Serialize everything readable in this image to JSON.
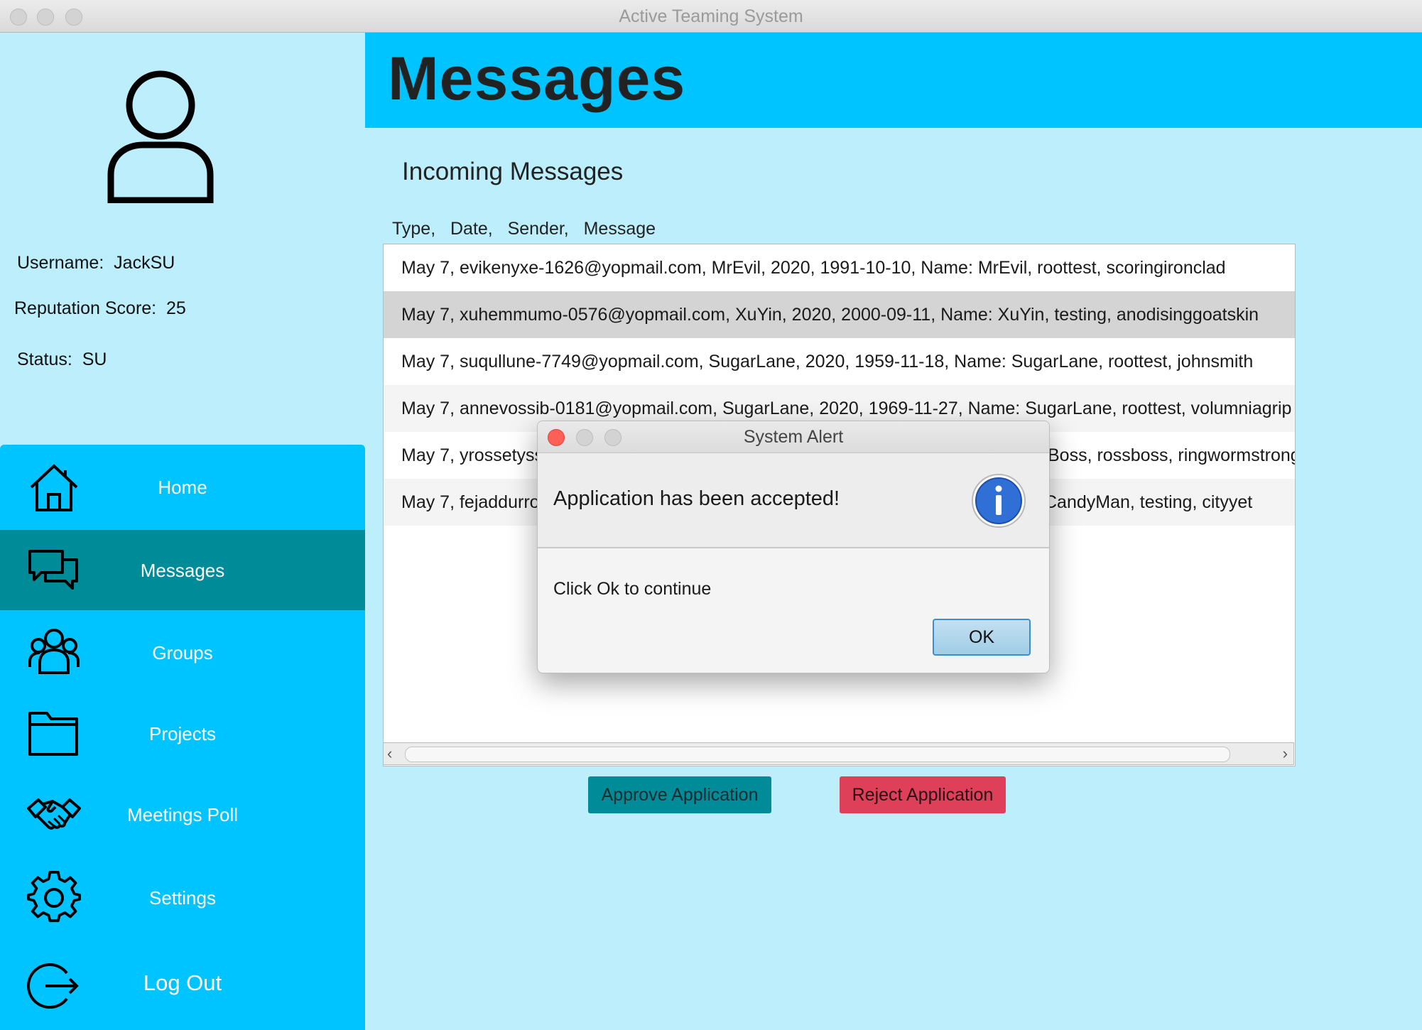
{
  "window": {
    "title": "Active Teaming System"
  },
  "profile": {
    "username_label": "Username:",
    "username": "JackSU",
    "reputation_label": "Reputation Score:",
    "reputation": "25",
    "status_label": "Status:",
    "status": "SU"
  },
  "nav": [
    {
      "label": "Home",
      "icon": "home-icon"
    },
    {
      "label": "Messages",
      "icon": "chat-icon",
      "active": true
    },
    {
      "label": "Groups",
      "icon": "users-icon"
    },
    {
      "label": "Projects",
      "icon": "folder-icon"
    },
    {
      "label": "Meetings Poll",
      "icon": "handshake-icon"
    },
    {
      "label": "Settings",
      "icon": "gear-icon"
    },
    {
      "label": "Log Out",
      "icon": "logout-icon"
    }
  ],
  "header": {
    "title": "Messages"
  },
  "main": {
    "section_title": "Incoming Messages",
    "columns": "Type,   Date,   Sender,   Message",
    "messages": [
      "May 7, evikenyxe-1626@yopmail.com, MrEvil,  2020, 1991-10-10, Name: MrEvil, roottest, scoringironclad",
      "May 7, xuhemmumo-0576@yopmail.com, XuYin,  2020, 2000-09-11, Name: XuYin, testing, anodisinggoatskin",
      "May 7, suqullune-7749@yopmail.com, SugarLane,  2020, 1959-11-18, Name: SugarLane, roottest, johnsmith",
      "May 7, annevossib-0181@yopmail.com, SugarLane,  2020, 1969-11-27, Name: SugarLane, roottest, volumniagrip",
      "May 7, yrossetyss",
      "May 7, fejaddurro"
    ],
    "messages_right_visible": [
      "",
      "",
      "",
      "",
      "Boss, rossboss, ringwormstrong",
      "CandyMan, testing, cityyet"
    ],
    "selected_row": 1,
    "approve_label": "Approve Application",
    "reject_label": "Reject Application"
  },
  "dialog": {
    "title": "System Alert",
    "header": "Application has been accepted!",
    "content": "Click Ok to continue",
    "ok_label": "OK"
  },
  "colors": {
    "accent": "#00c4ff",
    "background": "#bdeefc",
    "active_nav": "#008b99",
    "approve": "#008b99",
    "reject": "#de405a"
  }
}
